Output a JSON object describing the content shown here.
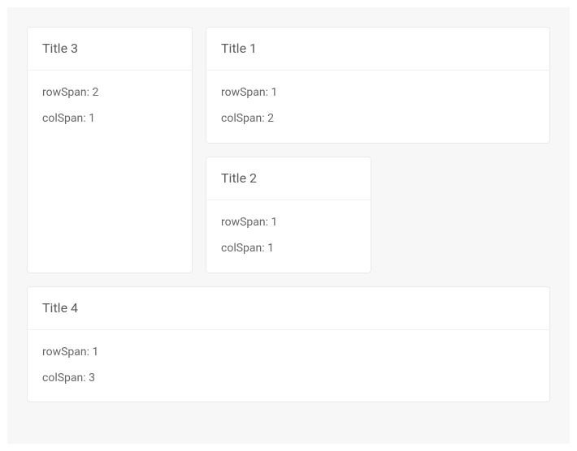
{
  "cards": [
    {
      "title": "Title 3",
      "rowSpanLabel": "rowSpan: 2",
      "colSpanLabel": "colSpan: 1"
    },
    {
      "title": "Title 1",
      "rowSpanLabel": "rowSpan: 1",
      "colSpanLabel": "colSpan: 2"
    },
    {
      "title": "Title 2",
      "rowSpanLabel": "rowSpan: 1",
      "colSpanLabel": "colSpan: 1"
    },
    {
      "title": "Title 4",
      "rowSpanLabel": "rowSpan: 1",
      "colSpanLabel": "colSpan: 3"
    }
  ]
}
